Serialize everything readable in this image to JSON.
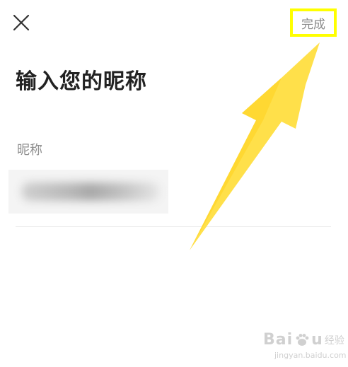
{
  "header": {
    "close_icon": "close-icon",
    "done_label": "完成",
    "highlight_color": "#ffff00"
  },
  "page": {
    "title": "输入您的昵称"
  },
  "form": {
    "nickname_label": "昵称",
    "nickname_value_obscured": true
  },
  "annotation": {
    "arrow_color": "#ffe04a"
  },
  "watermark": {
    "brand_latin_1": "Bai",
    "brand_latin_2": "u",
    "brand_cn": "经验",
    "url": "jingyan.baidu.com"
  }
}
